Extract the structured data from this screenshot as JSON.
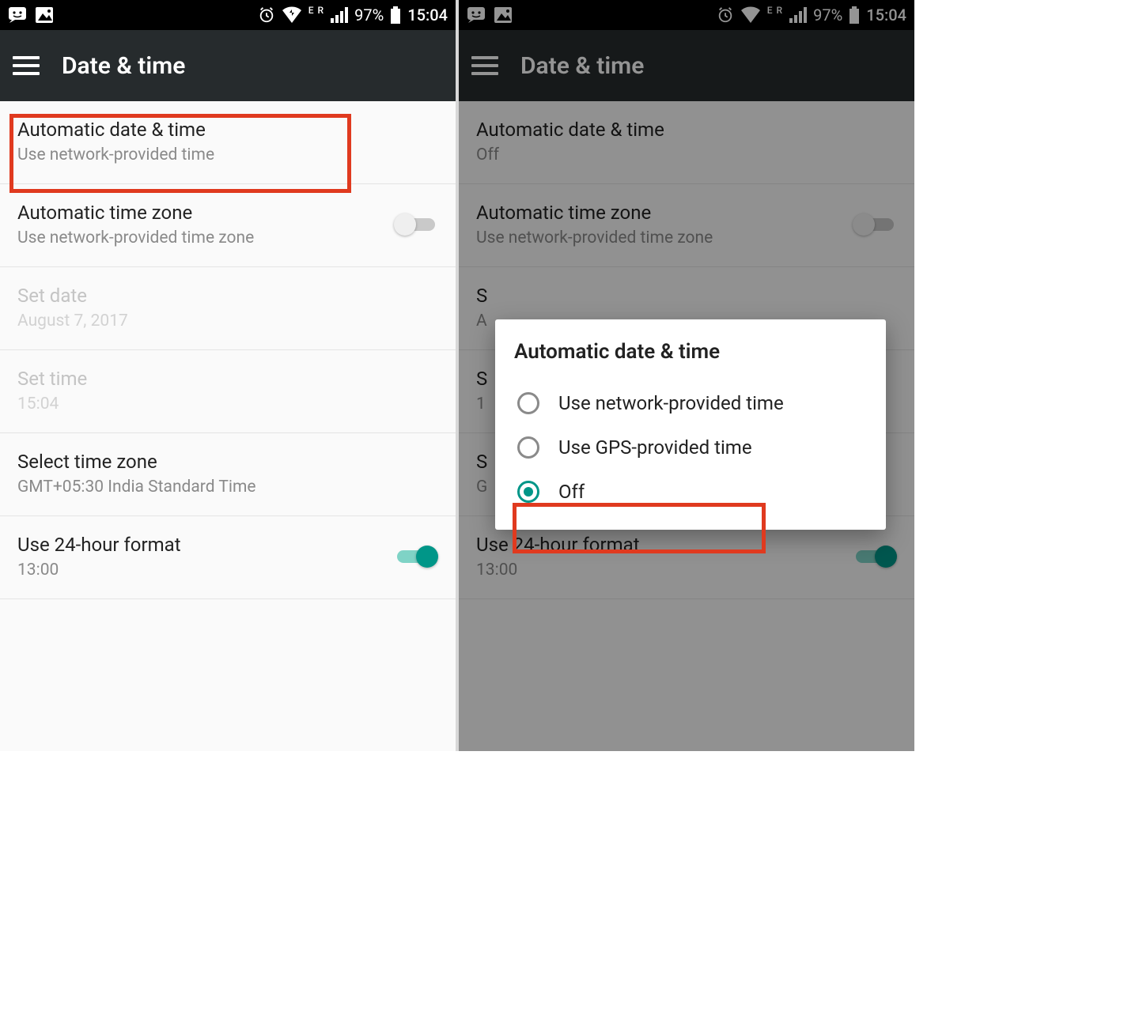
{
  "status": {
    "er_label": "E R",
    "battery_pct": "97%",
    "clock": "15:04"
  },
  "appbar": {
    "title": "Date & time"
  },
  "left": {
    "items": [
      {
        "title": "Automatic date & time",
        "sub": "Use network-provided time"
      },
      {
        "title": "Automatic time zone",
        "sub": "Use network-provided time zone"
      },
      {
        "title": "Set date",
        "sub": "August 7, 2017"
      },
      {
        "title": "Set time",
        "sub": "15:04"
      },
      {
        "title": "Select time zone",
        "sub": "GMT+05:30 India Standard Time"
      },
      {
        "title": "Use 24-hour format",
        "sub": "13:00"
      }
    ]
  },
  "right": {
    "items": [
      {
        "title": "Automatic date & time",
        "sub": "Off"
      },
      {
        "title": "Automatic time zone",
        "sub": "Use network-provided time zone"
      },
      {
        "title": "S",
        "sub": "A"
      },
      {
        "title": "S",
        "sub": "1"
      },
      {
        "title": "S",
        "sub": "G"
      },
      {
        "title": "Use 24-hour format",
        "sub": "13:00"
      }
    ],
    "dialog": {
      "title": "Automatic date & time",
      "options": [
        "Use network-provided time",
        "Use GPS-provided time",
        "Off"
      ],
      "selected_index": 2
    }
  }
}
